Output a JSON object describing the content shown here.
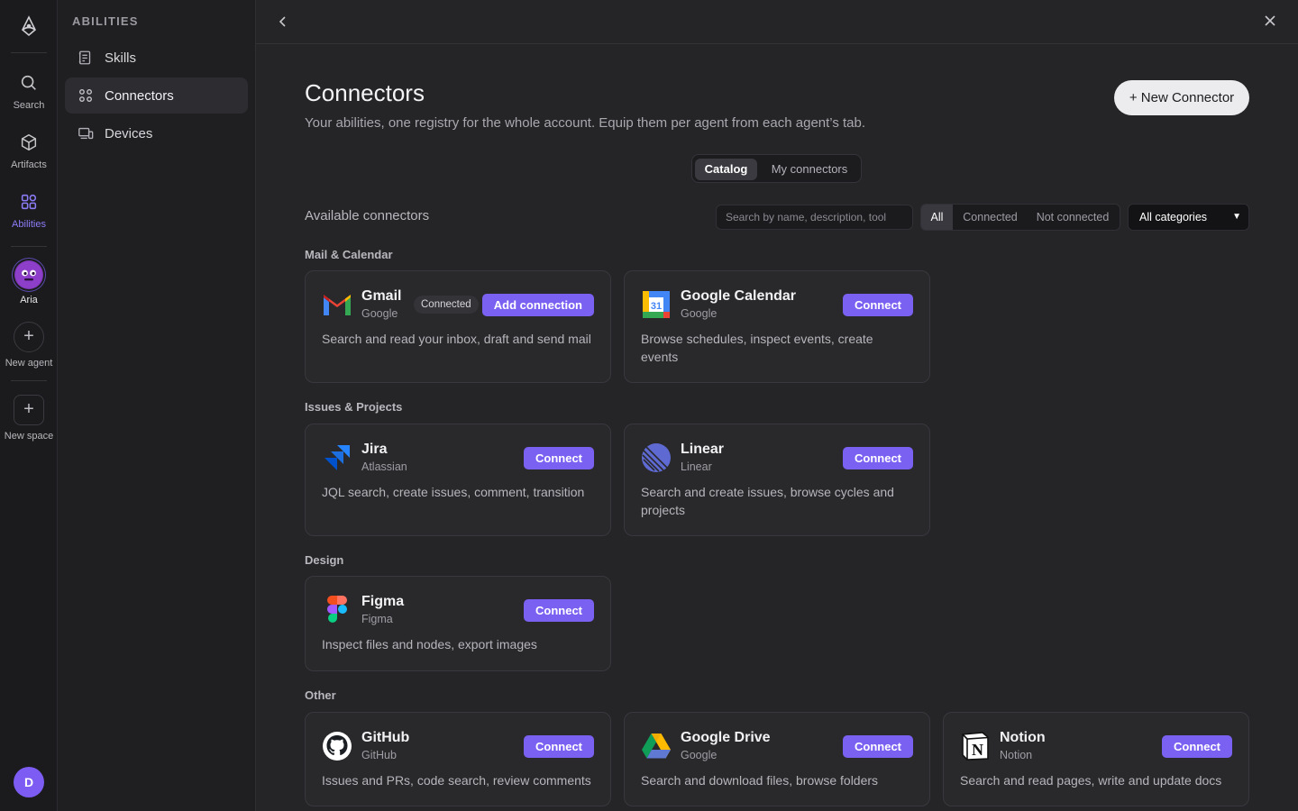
{
  "rail": {
    "items": [
      {
        "label": "Search",
        "icon": "search-icon"
      },
      {
        "label": "Artifacts",
        "icon": "cube-icon"
      },
      {
        "label": "Abilities",
        "icon": "grid-icon",
        "active": true
      },
      {
        "label": "Aria",
        "icon": "agent-avatar"
      },
      {
        "label": "New agent",
        "icon": "plus-icon"
      },
      {
        "label": "New space",
        "icon": "plus-icon"
      }
    ],
    "user_initial": "D"
  },
  "sidebar": {
    "heading": "ABILITIES",
    "items": [
      {
        "label": "Skills",
        "icon": "skills-icon"
      },
      {
        "label": "Connectors",
        "icon": "connectors-icon",
        "active": true
      },
      {
        "label": "Devices",
        "icon": "devices-icon"
      }
    ]
  },
  "page": {
    "title": "Connectors",
    "subtitle": "Your abilities, one registry for the whole account. Equip them per agent from each agent’s tab.",
    "new_button": "+ New Connector",
    "tabs": [
      "Catalog",
      "My connectors"
    ],
    "active_tab": "Catalog",
    "available_label": "Available connectors",
    "search_placeholder": "Search by name, description, tool",
    "filters": [
      "All",
      "Connected",
      "Not connected"
    ],
    "active_filter": "All",
    "category_select": "All categories"
  },
  "sections": [
    {
      "title": "Mail & Calendar",
      "cards": [
        {
          "name": "Gmail",
          "vendor": "Google",
          "desc": "Search and read your inbox, draft and send mail",
          "status": "Connected",
          "button": "Add connection",
          "icon": "gmail-icon"
        },
        {
          "name": "Google Calendar",
          "vendor": "Google",
          "desc": "Browse schedules, inspect events, create events",
          "button": "Connect",
          "icon": "google-calendar-icon",
          "icon_text": "31"
        }
      ]
    },
    {
      "title": "Issues & Projects",
      "cards": [
        {
          "name": "Jira",
          "vendor": "Atlassian",
          "desc": "JQL search, create issues, comment, transition",
          "button": "Connect",
          "icon": "jira-icon"
        },
        {
          "name": "Linear",
          "vendor": "Linear",
          "desc": "Search and create issues, browse cycles and projects",
          "button": "Connect",
          "icon": "linear-icon"
        }
      ]
    },
    {
      "title": "Design",
      "cards": [
        {
          "name": "Figma",
          "vendor": "Figma",
          "desc": "Inspect files and nodes, export images",
          "button": "Connect",
          "icon": "figma-icon"
        }
      ]
    },
    {
      "title": "Other",
      "cards": [
        {
          "name": "GitHub",
          "vendor": "GitHub",
          "desc": "Issues and PRs, code search, review comments",
          "button": "Connect",
          "icon": "github-icon"
        },
        {
          "name": "Google Drive",
          "vendor": "Google",
          "desc": "Search and download files, browse folders",
          "button": "Connect",
          "icon": "google-drive-icon"
        },
        {
          "name": "Notion",
          "vendor": "Notion",
          "desc": "Search and read pages, write and update docs",
          "button": "Connect",
          "icon": "notion-icon",
          "icon_text": "N"
        }
      ]
    }
  ],
  "colors": {
    "accent": "#7b61f2",
    "background": "#252528",
    "card": "#29292c"
  }
}
